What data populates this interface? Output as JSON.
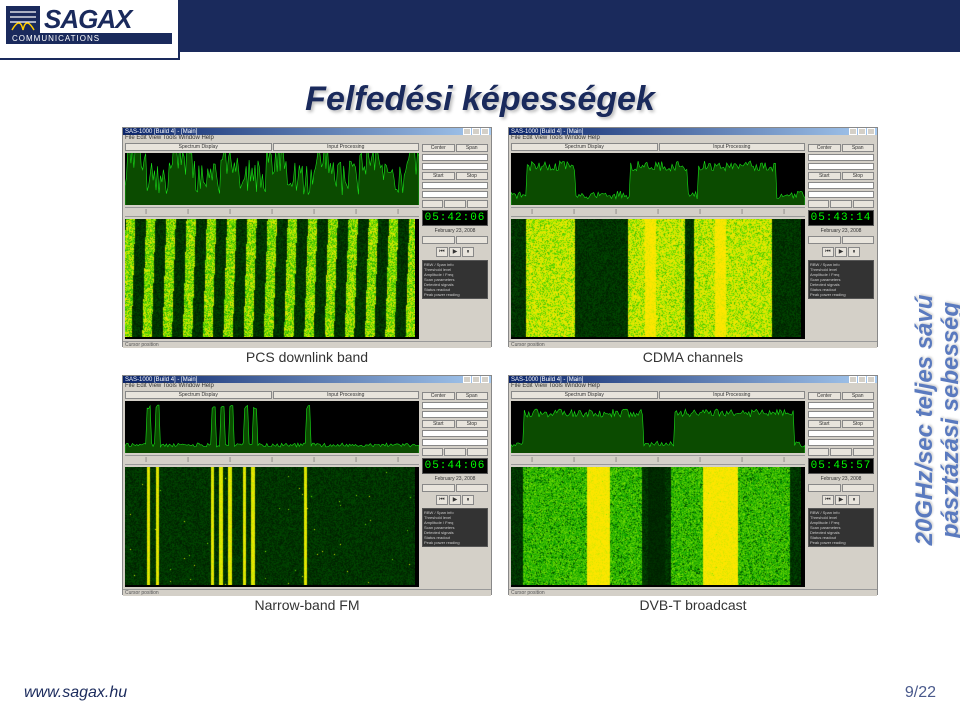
{
  "logo": {
    "brand": "SAGAX",
    "subtitle": "COMMUNICATIONS"
  },
  "title": "Felfedési képességek",
  "side_text": {
    "line1": "20GHz/sec teljes sávú",
    "line2": "pásztázási sebesség"
  },
  "panels": [
    {
      "caption": "PCS downlink band",
      "time": "05:42:06",
      "date": "February 23, 2008",
      "wf_type": "pcs"
    },
    {
      "caption": "CDMA channels",
      "time": "05:43:14",
      "date": "February 23, 2008",
      "wf_type": "cdma"
    },
    {
      "caption": "Narrow-band FM",
      "time": "05:44:06",
      "date": "February 23, 2008",
      "wf_type": "nbfm"
    },
    {
      "caption": "DVB-T broadcast",
      "time": "05:45:57",
      "date": "February 23, 2008",
      "wf_type": "dvbt"
    }
  ],
  "window": {
    "title": "SAS-1000  [Build 4] - [Main]",
    "menu": "File  Edit  View  Tools  Window  Help",
    "tabs": [
      "Spectrum Display",
      "Input Processing"
    ],
    "buttons": {
      "center": "Center",
      "span": "Span",
      "start": "Start",
      "stop": "Stop"
    },
    "statusbar": "Cursor position"
  },
  "footer": {
    "url": "www.sagax.hu",
    "page": "9/22"
  }
}
